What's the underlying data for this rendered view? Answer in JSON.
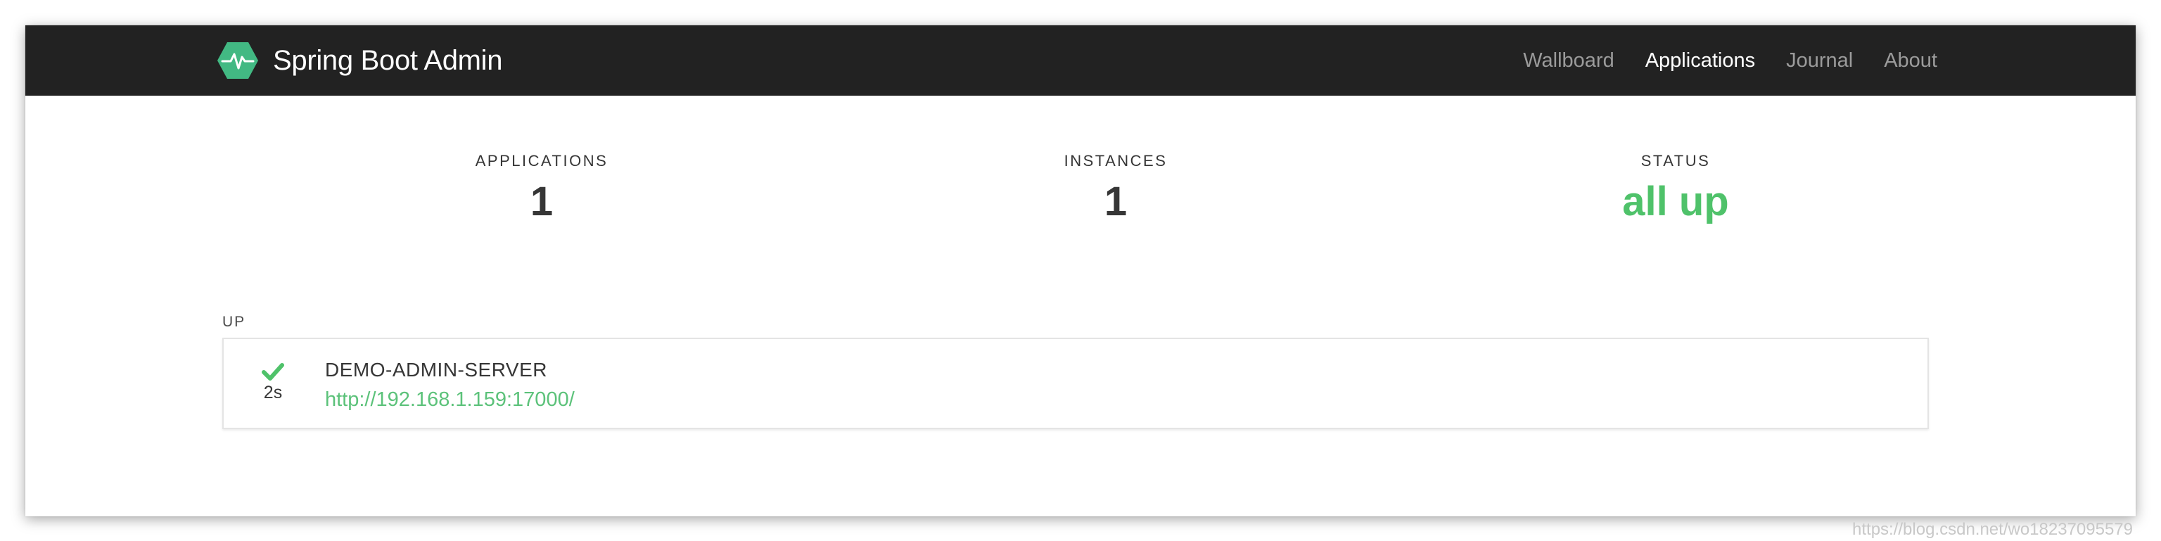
{
  "header": {
    "brand_title": "Spring Boot Admin",
    "logo_icon": "heartbeat-hexagon-icon",
    "logo_color": "#42b983",
    "nav": [
      {
        "label": "Wallboard",
        "active": false
      },
      {
        "label": "Applications",
        "active": true
      },
      {
        "label": "Journal",
        "active": false
      },
      {
        "label": "About",
        "active": false
      }
    ]
  },
  "stats": {
    "applications": {
      "label": "APPLICATIONS",
      "value": "1"
    },
    "instances": {
      "label": "INSTANCES",
      "value": "1"
    },
    "status": {
      "label": "STATUS",
      "value": "all up",
      "color": "#4fc26a"
    }
  },
  "groups": [
    {
      "label": "UP",
      "applications": [
        {
          "status_icon": "check-icon",
          "age": "2s",
          "name": "DEMO-ADMIN-SERVER",
          "url": "http://192.168.1.159:17000/"
        }
      ]
    }
  ],
  "watermark": "https://blog.csdn.net/wo18237095579",
  "colors": {
    "navbar_bg": "#222222",
    "nav_inactive": "#9b9b9b",
    "nav_active": "#ffffff",
    "accent_green": "#4fc26a"
  }
}
